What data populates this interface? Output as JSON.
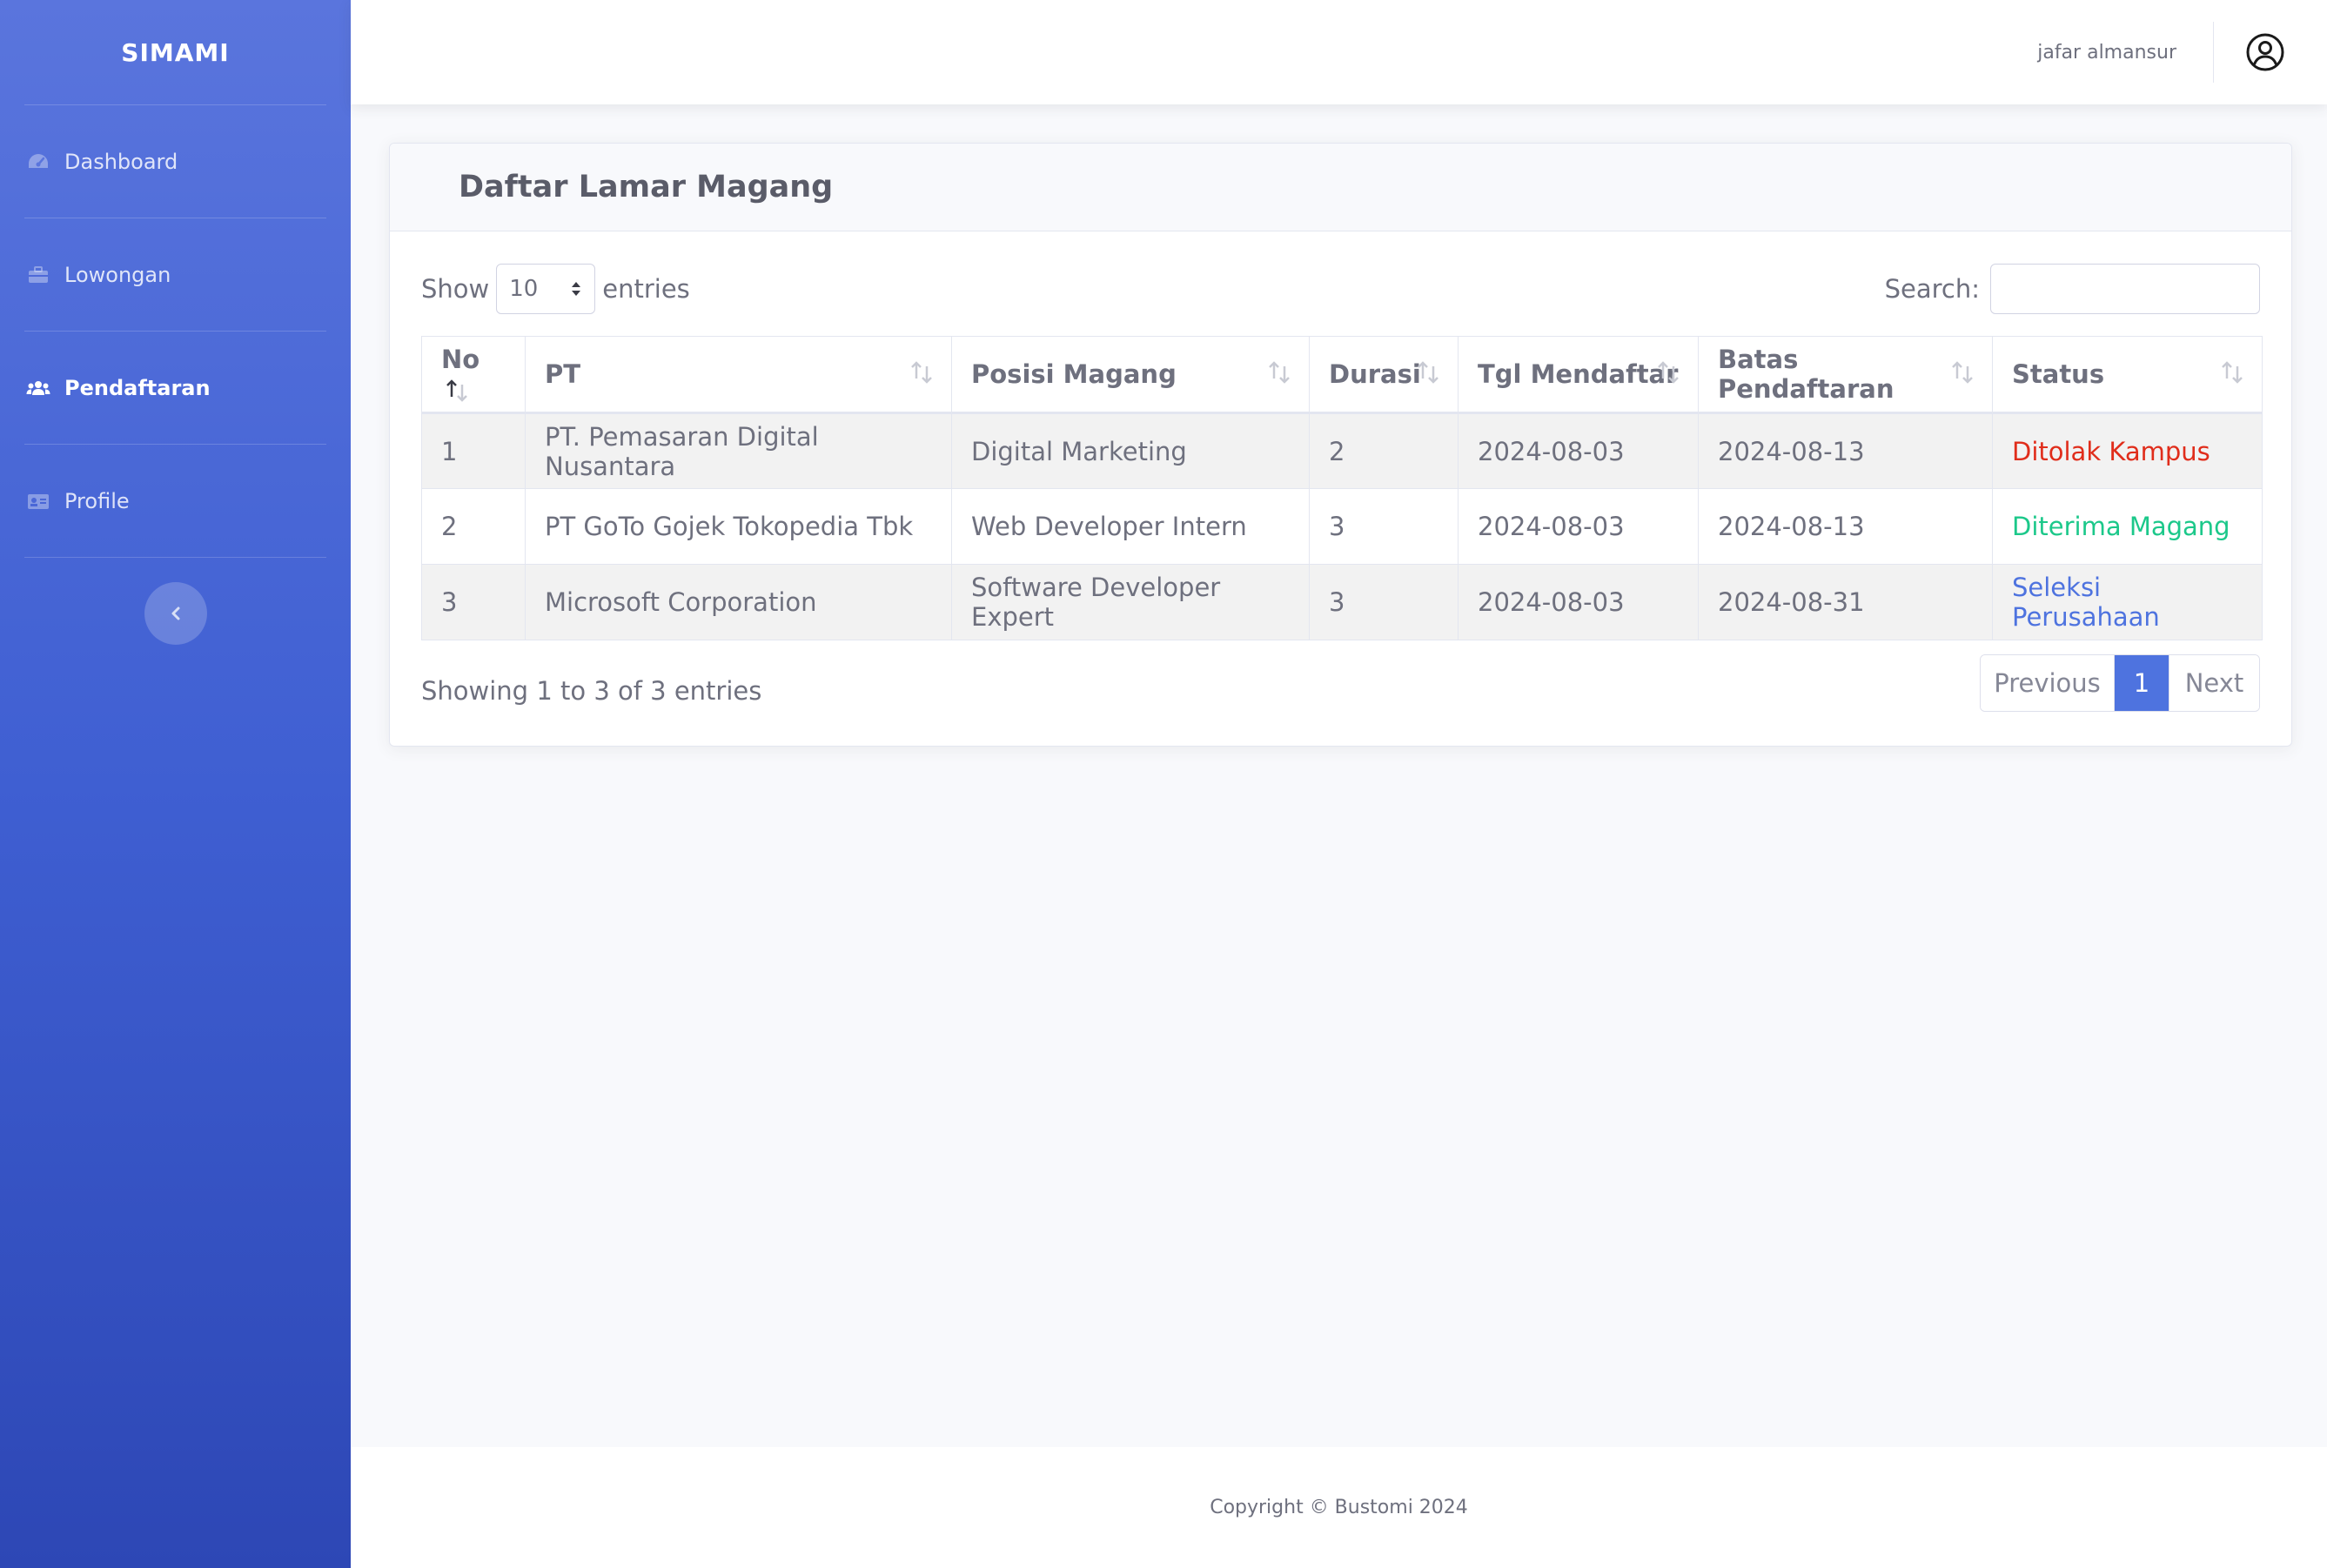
{
  "brand": "SIMAMI",
  "sidebar": {
    "items": [
      {
        "label": "Dashboard",
        "icon": "tachometer-icon"
      },
      {
        "label": "Lowongan",
        "icon": "briefcase-icon"
      },
      {
        "label": "Pendaftaran",
        "icon": "users-icon",
        "active": true
      },
      {
        "label": "Profile",
        "icon": "id-card-icon"
      }
    ],
    "toggle_icon": "chevron-left-icon"
  },
  "topbar": {
    "user_name": "jafar almansur",
    "avatar_icon": "user-circle-icon"
  },
  "card": {
    "title": "Daftar Lamar Magang"
  },
  "table_controls": {
    "show_label": "Show",
    "entries_value": "10",
    "entries_label": "entries",
    "search_label": "Search:",
    "search_value": ""
  },
  "table": {
    "headers": [
      "No",
      "PT",
      "Posisi Magang",
      "Durasi",
      "Tgl Mendaftar",
      "Batas Pendaftaran",
      "Status"
    ],
    "rows": [
      {
        "no": "1",
        "pt": "PT. Pemasaran Digital Nusantara",
        "posisi": "Digital Marketing",
        "durasi": "2",
        "tgl": "2024-08-03",
        "batas": "2024-08-13",
        "status": "Ditolak Kampus",
        "status_color": "#e02d1b"
      },
      {
        "no": "2",
        "pt": "PT GoTo Gojek Tokopedia Tbk",
        "posisi": "Web Developer Intern",
        "durasi": "3",
        "tgl": "2024-08-03",
        "batas": "2024-08-13",
        "status": "Diterima Magang",
        "status_color": "#1cc88a"
      },
      {
        "no": "3",
        "pt": "Microsoft Corporation",
        "posisi": "Software Developer Expert",
        "durasi": "3",
        "tgl": "2024-08-03",
        "batas": "2024-08-31",
        "status": "Seleksi Perusahaan",
        "status_color": "#4e73df"
      }
    ]
  },
  "table_info": "Showing 1 to 3 of 3 entries",
  "pagination": {
    "previous": "Previous",
    "current": "1",
    "next": "Next"
  },
  "footer": "Copyright © Bustomi 2024",
  "colors": {
    "primary": "#4e73df",
    "sidebar_top": "#5a75dd",
    "sidebar_bottom": "#2d47b5"
  }
}
